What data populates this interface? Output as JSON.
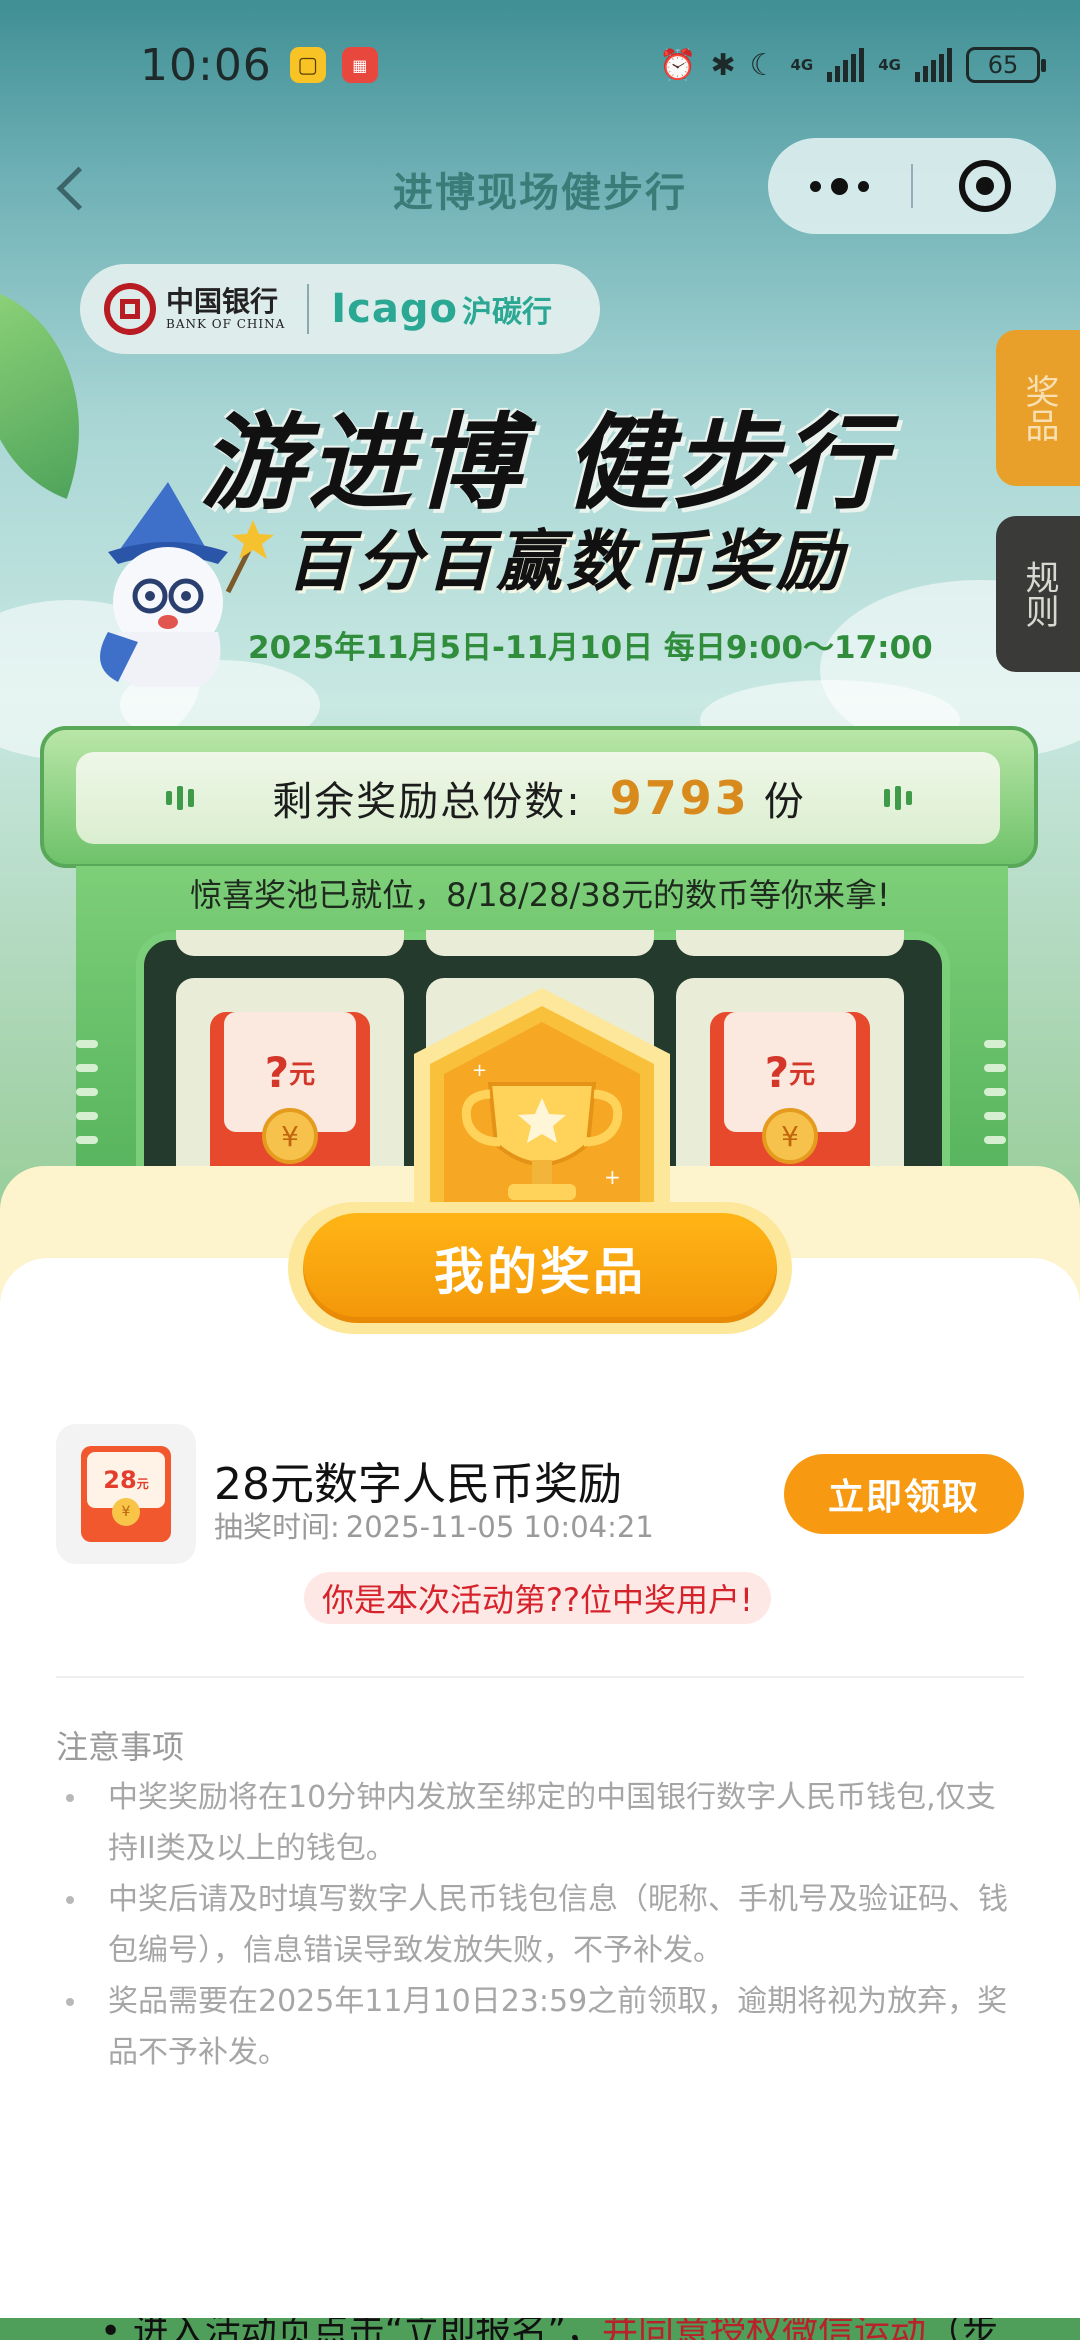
{
  "status_bar": {
    "time": "10:06",
    "battery": "65",
    "network_1": "4G",
    "network_2": "4G"
  },
  "nav": {
    "title": "进博现场健步行"
  },
  "sponsor": {
    "boc_cn": "中国银行",
    "boc_en": "BANK OF CHINA",
    "icago": "Icago",
    "icago_cn": "沪碳行"
  },
  "side_tabs": {
    "prize": "奖品",
    "rules": "规则"
  },
  "hero": {
    "title": "游进博 健步行",
    "subtitle": "百分百赢数币奖励",
    "date": "2025年11月5日-11月10日 每日9:00～17:00"
  },
  "remaining": {
    "label": "剩余奖励总份数:",
    "count": "9793",
    "unit": "份"
  },
  "machine": {
    "pool_note": "惊喜奖池已就位，8/18/28/38元的数币等你来拿!",
    "slot_amount": "?",
    "slot_unit": "元",
    "coin_symbol": "¥"
  },
  "sheet": {
    "title": "我的奖品",
    "prize": {
      "thumb_amount": "28",
      "thumb_unit": "元",
      "thumb_coin": "¥",
      "name": "28元数字人民币奖励",
      "time_label": "抽奖时间:",
      "time_value": "2025-11-05 10:04:21",
      "claim_label": "立即领取"
    },
    "winner_tag": "你是本次活动第??位中奖用户!",
    "notes_title": "注意事项",
    "notes": [
      "中奖奖励将在10分钟内发放至绑定的中国银行数字人民币钱包,仅支持II类及以上的钱包。",
      "中奖后请及时填写数字人民币钱包信息（昵称、手机号及验证码、钱包编号），信息错误导致发放失败，不予补发。",
      "奖品需要在2025年11月10日23:59之前领取，逾期将视为放弃，奖品不予补发。"
    ]
  },
  "bottom_peek": {
    "text": "进入活动页点击“立即报名”，",
    "highlight": "并同意授权微信运动",
    "tail": "（步"
  },
  "colors": {
    "accent_orange": "#f79a12",
    "winner_red": "#d6222a",
    "count_orange": "#d98a1c",
    "date_green": "#2f8d3c"
  },
  "icons": [
    "back-arrow-icon",
    "more-dots-icon",
    "close-target-icon",
    "alarm-icon",
    "bluetooth-icon",
    "moon-icon",
    "signal-icon",
    "battery-icon",
    "trophy-icon",
    "red-packet-icon",
    "coin-icon"
  ]
}
